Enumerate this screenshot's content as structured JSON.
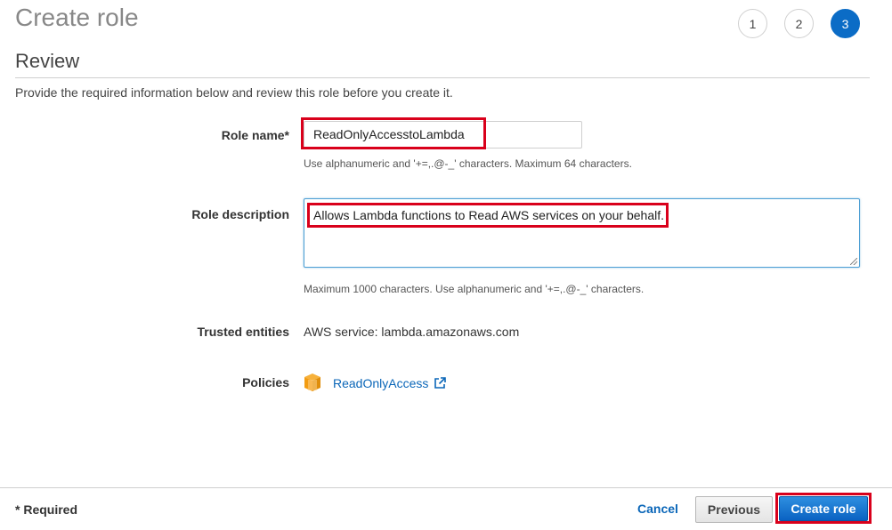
{
  "page": {
    "title": "Create role"
  },
  "steps": [
    "1",
    "2",
    "3"
  ],
  "review": {
    "title": "Review",
    "intro": "Provide the required information below and review this role before you create it."
  },
  "role_name": {
    "label": "Role name*",
    "value": "ReadOnlyAccesstoLambda",
    "hint": "Use alphanumeric and '+=,.@-_' characters. Maximum 64 characters."
  },
  "role_description": {
    "label": "Role description",
    "value": "Allows Lambda functions to Read AWS services on your behalf.",
    "hint": "Maximum 1000 characters. Use alphanumeric and '+=,.@-_' characters."
  },
  "trusted_entities": {
    "label": "Trusted entities",
    "value": "AWS service: lambda.amazonaws.com"
  },
  "policies": {
    "label": "Policies",
    "items": [
      {
        "name": "ReadOnlyAccess",
        "icon": "aws-policy-cube-icon"
      }
    ]
  },
  "footer": {
    "required_note": "* Required",
    "cancel_label": "Cancel",
    "previous_label": "Previous",
    "create_label": "Create role"
  },
  "colors": {
    "accent": "#0b6cc6",
    "link": "#0a66b8",
    "highlight": "#d9001b",
    "policy_icon": "#f5a623"
  }
}
